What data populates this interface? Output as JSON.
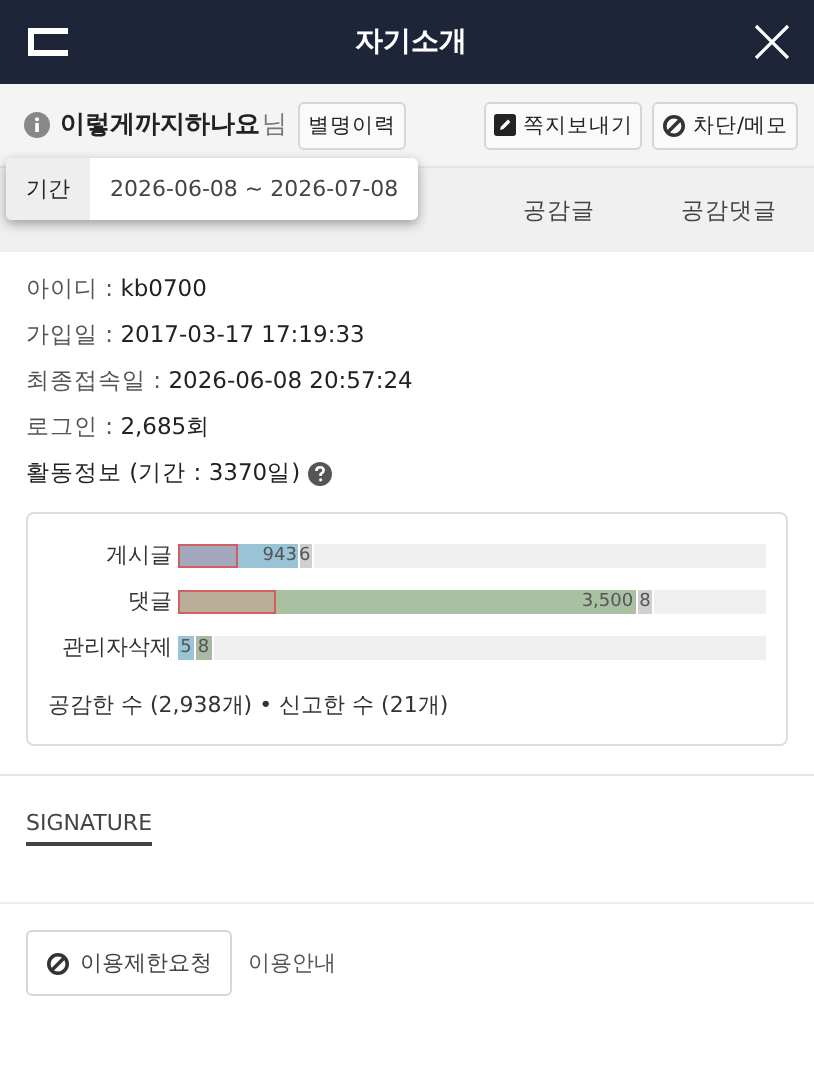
{
  "header": {
    "title": "자기소개"
  },
  "user": {
    "nickname": "이렇게까지하나요",
    "suffix": "님",
    "buttons": [
      {
        "label": "별명이력",
        "kind": "plain"
      },
      {
        "label": "쪽지보내기",
        "kind": "message"
      },
      {
        "label": "차단/메모",
        "kind": "block"
      }
    ]
  },
  "tabs": [
    {
      "label": "공감글",
      "selected": false
    },
    {
      "label": "공감댓글",
      "selected": false
    }
  ],
  "period_popover": {
    "label": "기간",
    "value": "2026-06-08 ~ 2026-07-08"
  },
  "info": [
    {
      "label": "아이디 :",
      "value": "kb0700"
    },
    {
      "label": "가입일 :",
      "value": "2017-03-17 17:19:33"
    },
    {
      "label": "최종접속일 :",
      "value": "2026-06-08 20:57:24"
    },
    {
      "label": "로그인 :",
      "value": "2,685회"
    }
  ],
  "activity_title": "활동정보 (기간 : 3370일)",
  "activity": {
    "rows": [
      {
        "label": "게시글",
        "segments": [
          {
            "color": "#a3a8bd",
            "outlined": true
          },
          {
            "color": "#98c4d6",
            "value": "943",
            "outlined": false
          },
          {
            "color": "#cfcfcf",
            "value": "6",
            "outlined": false
          }
        ]
      },
      {
        "label": "댓글",
        "segments": [
          {
            "color": "#b9ae98",
            "outlined": true
          },
          {
            "color": "#a9c0a3",
            "value": "3,500",
            "outlined": false
          },
          {
            "color": "#cfcfcf",
            "value": "8",
            "outlined": false
          }
        ]
      },
      {
        "label": "관리자삭제",
        "segments": [
          {
            "color": "#98c4d6",
            "value": "5",
            "outlined": false
          },
          {
            "color": "#a9b9a3",
            "value": "8",
            "outlined": false
          }
        ]
      }
    ],
    "summary": "공감한 수 (2,938개) • 신고한 수 (21개)"
  },
  "signature": {
    "title": "SIGNATURE"
  },
  "footer": {
    "button": "이용제한요청",
    "link": "이용안내"
  }
}
